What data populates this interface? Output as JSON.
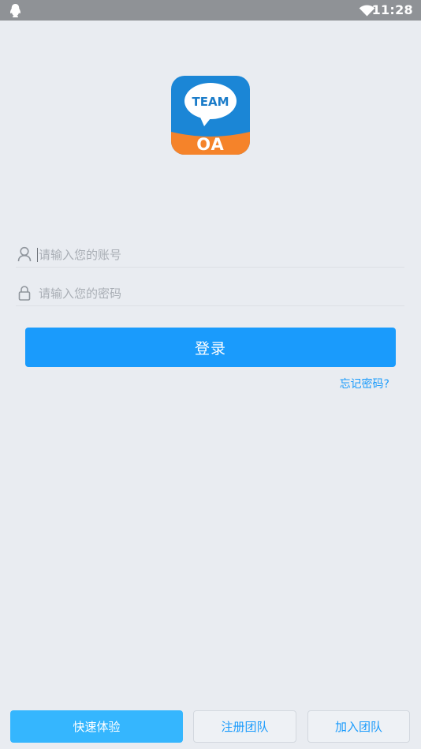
{
  "status_bar": {
    "time": "11:28",
    "notification_icon": "qq-penguin-icon",
    "signal_icon": "wifi-icon"
  },
  "logo": {
    "top_text": "TEAM",
    "bottom_text": "OA"
  },
  "form": {
    "account": {
      "icon": "user-icon",
      "placeholder": "请输入您的账号",
      "value": ""
    },
    "password": {
      "icon": "lock-icon",
      "placeholder": "请输入您的密码",
      "value": ""
    },
    "login_label": "登录",
    "forgot_label": "忘记密码?"
  },
  "bottom_actions": [
    {
      "label": "快速体验"
    },
    {
      "label": "注册团队"
    },
    {
      "label": "加入团队"
    }
  ],
  "colors": {
    "background": "#e9ecf1",
    "status_bar": "#8f9296",
    "accent": "#1a9bfc",
    "quick_start": "#35b6fe",
    "logo_blue": "#1b86d6",
    "logo_orange": "#f5832a",
    "placeholder": "#a9aeb5",
    "icon_gray": "#8f959c"
  }
}
